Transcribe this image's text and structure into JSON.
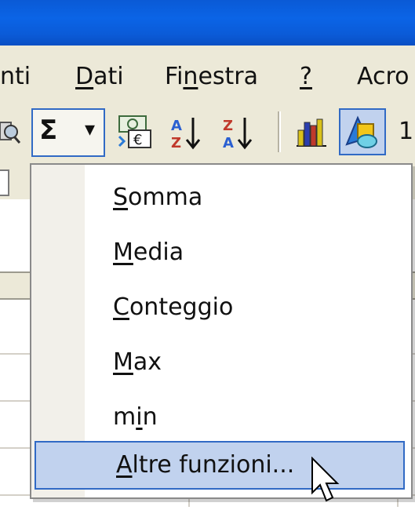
{
  "menubar": {
    "items": [
      {
        "label": "nti",
        "mnemonic": ""
      },
      {
        "label": "Dati",
        "mnemonic": "D"
      },
      {
        "label": "Finestra",
        "mnemonic": "n"
      },
      {
        "label": "?",
        "mnemonic": "?"
      },
      {
        "label": "Acro",
        "mnemonic": ""
      }
    ]
  },
  "toolbar": {
    "autosum_symbol": "Σ",
    "autosum_arrow": "▾",
    "euro_icon": "euro-conversion-icon",
    "sort_asc_letters": "AZ",
    "sort_desc_letters": "ZA",
    "chart_icon": "chart-wizard-icon",
    "drawing_icon": "drawing-icon",
    "zoom_partial": "1",
    "colors": {
      "sum_button_border": "#316ac5",
      "sum_button_bg": "#f6f5ef"
    }
  },
  "autosum_menu": {
    "items": [
      {
        "pre": "",
        "mn": "S",
        "post": "omma"
      },
      {
        "pre": "",
        "mn": "M",
        "post": "edia"
      },
      {
        "pre": "",
        "mn": "C",
        "post": "onteggio"
      },
      {
        "pre": "",
        "mn": "M",
        "post": "ax"
      },
      {
        "pre": "m",
        "mn": "i",
        "post": "n"
      },
      {
        "pre": "",
        "mn": "A",
        "post": "ltre funzioni..."
      }
    ],
    "highlighted_index": 5,
    "colors": {
      "highlight_bg": "#c1d2ee",
      "highlight_border": "#316ac5"
    }
  },
  "window": {
    "titlebar_color": "#0b5ed8",
    "menubar_color": "#ece9d8"
  }
}
